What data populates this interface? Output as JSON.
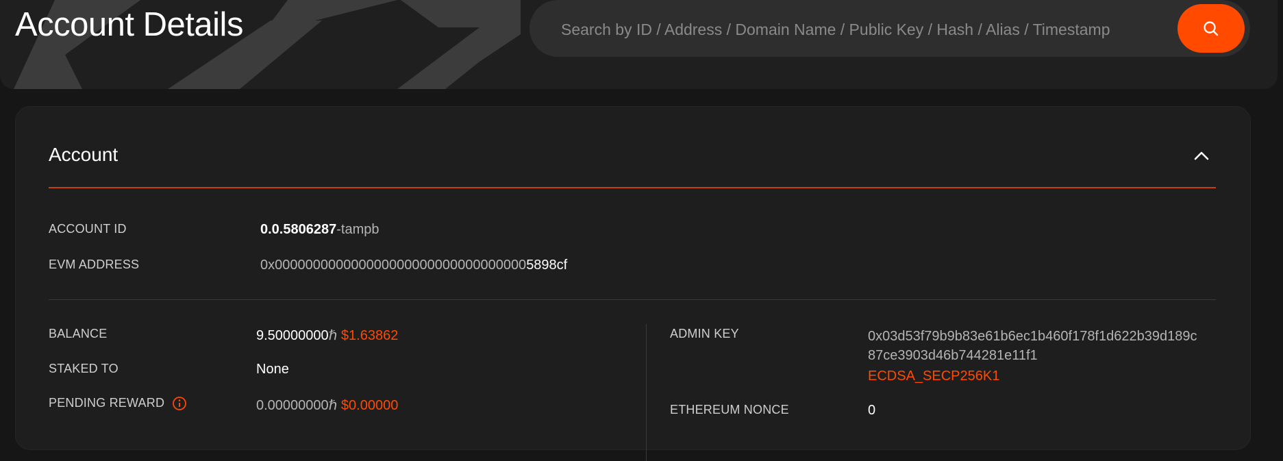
{
  "header": {
    "title": "Account Details",
    "search_placeholder": "Search by ID / Address / Domain Name / Public Key / Hash / Alias / Timestamp"
  },
  "card": {
    "title": "Account"
  },
  "account": {
    "account_id_label": "ACCOUNT ID",
    "account_id_value": "0.0.5806287",
    "account_id_checksum": "-tampb",
    "evm_address_label": "EVM ADDRESS",
    "evm_address_prefix": "0x000000000000000000000000000000000",
    "evm_address_suffix": "5898cf"
  },
  "left_fields": {
    "balance_label": "BALANCE",
    "balance_value": "9.50000000",
    "balance_unit": "ℏ",
    "balance_usd": "$1.63862",
    "staked_to_label": "STAKED TO",
    "staked_to_value": "None",
    "pending_reward_label": "PENDING REWARD",
    "pending_reward_value": "0.00000000",
    "pending_reward_unit": "ℏ",
    "pending_reward_usd": "$0.00000"
  },
  "right_fields": {
    "admin_key_label": "ADMIN KEY",
    "admin_key_line1": "0x03d53f79b9b83e61b6ec1b460f178f1d622b39d189c",
    "admin_key_line2": "87ce3903d46b744281e11f1",
    "admin_key_type": "ECDSA_SECP256K1",
    "ethereum_nonce_label": "ETHEREUM NONCE",
    "ethereum_nonce_value": "0"
  },
  "icons": {
    "search": "search-icon",
    "collapse": "chevron-up-icon",
    "info": "info-icon"
  },
  "colors": {
    "accent": "#ff4a00",
    "background": "#161616",
    "card": "#1e1e1e"
  }
}
